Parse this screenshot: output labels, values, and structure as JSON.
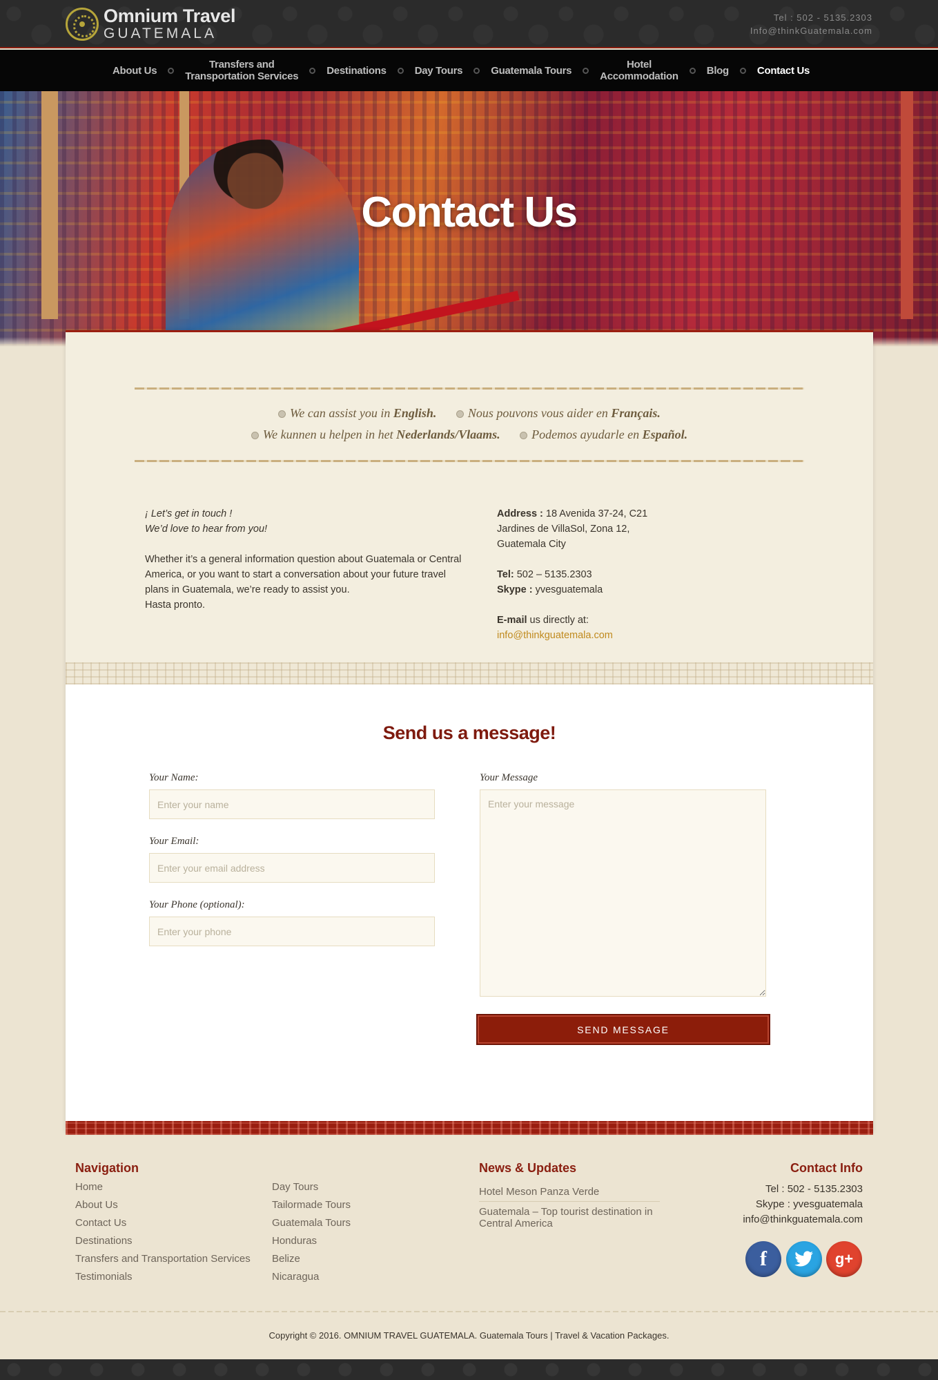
{
  "header": {
    "logo_line1": "Omnium Travel",
    "logo_line2": "GUATEMALA",
    "tel": "Tel : 502 - 5135.2303",
    "email": "Info@thinkGuatemala.com"
  },
  "nav": {
    "items": [
      {
        "label": "About Us"
      },
      {
        "label_line1": "Transfers and",
        "label_line2": "Transportation Services"
      },
      {
        "label": "Destinations"
      },
      {
        "label": "Day Tours"
      },
      {
        "label": "Guatemala Tours"
      },
      {
        "label_line1": "Hotel",
        "label_line2": "Accommodation"
      },
      {
        "label": "Blog"
      },
      {
        "label": "Contact Us",
        "active": true
      }
    ]
  },
  "hero": {
    "title": "Contact Us"
  },
  "languages": {
    "en_prefix": "We can assist you in",
    "en_lang": "English.",
    "fr_prefix": "Nous pouvons vous aider en",
    "fr_lang": "Français.",
    "nl_prefix": "We kunnen u helpen in het",
    "nl_lang": "Nederlands/Vlaams.",
    "es_prefix": "Podemos ayudarle en",
    "es_lang": "Español."
  },
  "intro": {
    "greeting_line1": "¡ Let’s get in touch !",
    "greeting_line2": "We’d love to hear from you!",
    "body": "Whether it’s a general information question about Guatemala or Central America, or you want to start a conversation about your future travel plans in Guatemala, we’re ready to assist you.",
    "closing": "Hasta pronto."
  },
  "contact_details": {
    "address_label": "Address :",
    "address_line1": " 18 Avenida 37-24, C21",
    "address_line2": "Jardines de VillaSol, Zona 12,",
    "address_line3": "Guatemala City",
    "tel_label": "Tel:",
    "tel_value": " 502 – 5135.2303",
    "skype_label": "Skype :",
    "skype_value": " yvesguatemala",
    "email_label": "E-mail",
    "email_suffix": " us directly at:",
    "email_value": "info@thinkguatemala.com"
  },
  "form": {
    "title": "Send us a message!",
    "name_label": "Your Name:",
    "name_placeholder": "Enter your name",
    "email_label": "Your Email:",
    "email_placeholder": "Enter your email address",
    "phone_label": "Your Phone (optional):",
    "phone_placeholder": "Enter your phone",
    "message_label": "Your Message",
    "message_placeholder": "Enter your message",
    "submit_label": "SEND MESSAGE"
  },
  "footer": {
    "nav_heading": "Navigation",
    "nav_col1": [
      "Home",
      "About Us",
      "Contact Us",
      "Destinations",
      "Transfers and Transportation Services",
      "Testimonials"
    ],
    "nav_col2": [
      "Day Tours",
      "Tailormade Tours",
      "Guatemala Tours",
      "Honduras",
      "Belize",
      "Nicaragua"
    ],
    "news_heading": "News & Updates",
    "news": [
      "Hotel Meson Panza Verde",
      "Guatemala – Top tourist destination in Central America"
    ],
    "contact_heading": "Contact Info",
    "contact_tel": "Tel : 502 - 5135.2303",
    "contact_skype": "Skype : yvesguatemala",
    "contact_email": "info@thinkguatemala.com",
    "social": [
      {
        "icon": "facebook-icon",
        "glyph": "f",
        "color": "#3b5e9e"
      },
      {
        "icon": "twitter-icon",
        "glyph": "t",
        "color": "#2aa4e2"
      },
      {
        "icon": "google-plus-icon",
        "glyph": "g+",
        "color": "#e0432e"
      }
    ],
    "copyright": "Copyright © 2016. OMNIUM TRAVEL GUATEMALA. Guatemala Tours | Travel & Vacation Packages."
  },
  "colors": {
    "accent_red": "#8a1e10",
    "link_gold": "#c08a1e",
    "nav_bg": "#060606"
  }
}
